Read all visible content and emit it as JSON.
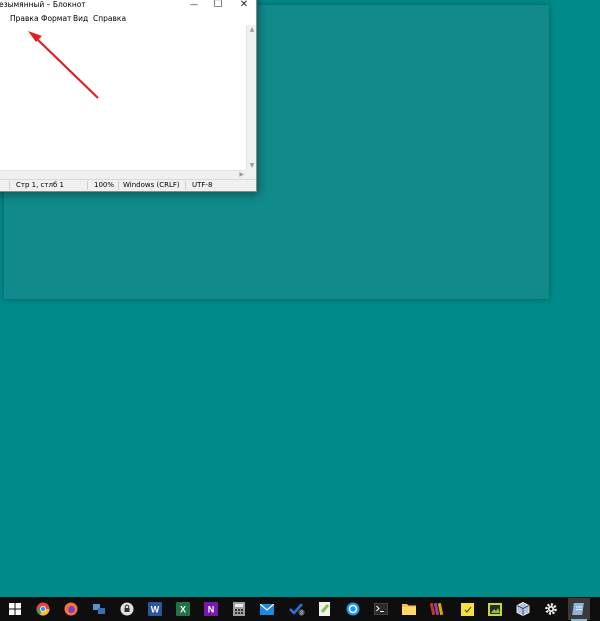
{
  "notepad": {
    "title": "езымянный – Блокнот",
    "controls": {
      "minimize": "—",
      "maximize": "☐",
      "close": "✕"
    },
    "menu": [
      "Правка",
      "Формат",
      "Вид",
      "Справка"
    ],
    "status": {
      "position": "Стр 1, стлб 1",
      "zoom": "100%",
      "line_ending": "Windows (CRLF)",
      "encoding": "UTF-8"
    }
  },
  "taskbar": {
    "icons": [
      {
        "name": "windows-start-icon",
        "color": "#ffffff"
      },
      {
        "name": "chrome-icon",
        "color": "#e8453c"
      },
      {
        "name": "firefox-icon",
        "color": "#ff7139"
      },
      {
        "name": "network-icon",
        "color": "#5b8fd1"
      },
      {
        "name": "lock-icon",
        "color": "#e0e0e0"
      },
      {
        "name": "word-icon",
        "color": "#2b579a"
      },
      {
        "name": "excel-icon",
        "color": "#217346"
      },
      {
        "name": "onenote-icon",
        "color": "#7719aa"
      },
      {
        "name": "calculator-icon",
        "color": "#9aa0a6"
      },
      {
        "name": "mail-icon",
        "color": "#1e88e5"
      },
      {
        "name": "todo-icon",
        "color": "#2f6fd6",
        "badge": "3"
      },
      {
        "name": "notepadpp-icon",
        "color": "#8bc34a"
      },
      {
        "name": "settings-circle-icon",
        "color": "#2196f3"
      },
      {
        "name": "terminal-icon",
        "color": "#2b2b2b"
      },
      {
        "name": "file-explorer-icon",
        "color": "#f5c542"
      },
      {
        "name": "winrar-icon",
        "color": "#c0392b"
      },
      {
        "name": "sticky-notes-icon",
        "color": "#f7e13a"
      },
      {
        "name": "image-viewer-icon",
        "color": "#c6d83a"
      },
      {
        "name": "virtualbox-icon",
        "color": "#aac4e0"
      },
      {
        "name": "gear-icon",
        "color": "#ffffff"
      },
      {
        "name": "notepad-icon",
        "color": "#8fb3d9"
      }
    ]
  },
  "colors": {
    "desktop": "#008b8b",
    "annotation": "#e02020"
  }
}
